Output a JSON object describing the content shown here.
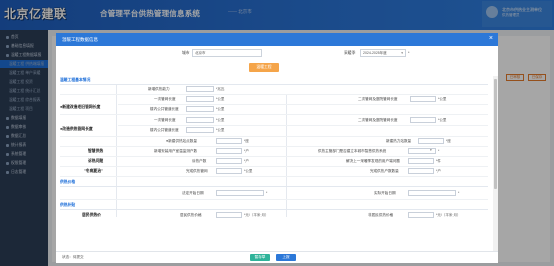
{
  "watermark": "北京亿建联",
  "app": {
    "title": "合管理平台供热管理信息系统",
    "subtitle": "—— 北京市"
  },
  "user": {
    "name": "北京市供热业主测单位",
    "role": "供热管理员"
  },
  "sidebar": {
    "items": [
      {
        "label": "首页"
      },
      {
        "label": "基础信息填报"
      },
      {
        "label": "温暖工程数据填报"
      },
      {
        "label": "温暖工程 供热端填报"
      },
      {
        "label": "温暖工程 单户采暖"
      },
      {
        "label": "温暖工程 投资"
      },
      {
        "label": "温暖工程 统计汇总"
      },
      {
        "label": "温暖工程 综合报表"
      },
      {
        "label": "温暖工程 项目"
      },
      {
        "label": "数据填报"
      },
      {
        "label": "数据审核"
      },
      {
        "label": "数据汇总"
      },
      {
        "label": "统计报表"
      },
      {
        "label": "系统管理"
      },
      {
        "label": "权限管理"
      },
      {
        "label": "日志管理"
      }
    ]
  },
  "background": {
    "btn1": "已审核",
    "btn2": "已保存"
  },
  "modal": {
    "title": "温暖工程数据信息",
    "close": "×",
    "filters": {
      "city_label": "城市",
      "city_value": "北京市",
      "year_label": "采暖季",
      "year_value": "2024-2025年度",
      "year_arrow": "▾",
      "star": "*"
    },
    "tab": "温暖工程",
    "sections": {
      "basic": "温暖工程基本情况",
      "price": "供热价格",
      "subsidy": "供热补贴"
    },
    "rows": {
      "r1": {
        "label": "新增供热能力",
        "unit": "*兆瓦"
      },
      "g1": "●新建改造老旧管网长度",
      "r2": {
        "label": "一次管网长度",
        "unit": "*公里",
        "label_r": "二次管网及庭院管网长度",
        "unit_r": "*公里"
      },
      "r3": {
        "label": "楼内公共管道长度",
        "unit": "*公里"
      },
      "g2": "●改造供热管网长度",
      "r4": {
        "label": "一次管网长度",
        "unit": "*公里",
        "label_r": "二次管网及庭院管网长度",
        "unit_r": "*公里"
      },
      "r5": {
        "label": "楼内公共管道长度",
        "unit": "*公里"
      },
      "r6": {
        "label": "●新建供热站点数量",
        "unit": "*座",
        "label_r": "新建热力站数量",
        "unit_r": "*座"
      },
      "g3": "智慧供热",
      "r7": {
        "label": "新增安装用户室温监测户数",
        "unit": "*户",
        "label_r": "供热主管部门是否建立本城市智慧供热系统",
        "unit_r": "*"
      },
      "g4": "诉热问题",
      "r8": {
        "label": "诉热户数",
        "unit": "*户",
        "label_r": "解决上一采暖季发现的用户端问题",
        "unit_r": "*件"
      },
      "g5": "\"冬病夏治\"",
      "r9": {
        "label": "完成供热管网",
        "unit": "*公里",
        "label_r": "完成供热户数数量",
        "unit_r": "*户"
      },
      "r10": {
        "label": "法定开始日期",
        "unit": "*",
        "label_r": "实际开始日期",
        "unit_r": "*"
      },
      "g6": "居民供热价",
      "r11": {
        "label": "居民供热价格",
        "unit": "*元/（平米·月）",
        "label_r": "非居民供热价格",
        "unit_r": "*元/（平米·月）"
      }
    },
    "footer": {
      "status": "状态：待提交",
      "save": "暂存草",
      "submit": "上报"
    },
    "colors": {
      "header": "#2c78d8",
      "tab": "#f5a54a",
      "save": "#2fb39a",
      "submit": "#2c78d8"
    }
  }
}
